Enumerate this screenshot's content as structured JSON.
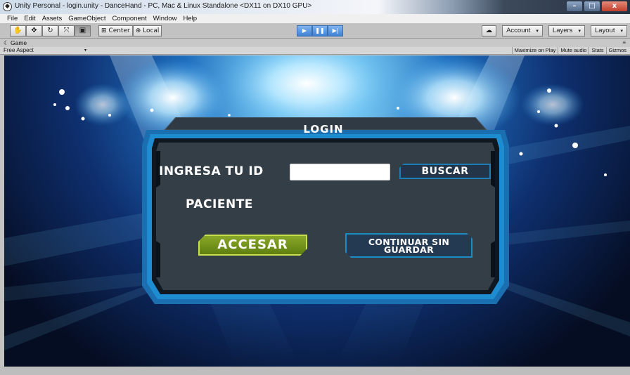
{
  "window": {
    "title": "Unity Personal - login.unity - DanceHand - PC, Mac & Linux Standalone <DX11 on DX10 GPU>",
    "controls": {
      "minimize": "–",
      "maximize": "□",
      "close": "x"
    }
  },
  "menubar": {
    "items": [
      "File",
      "Edit",
      "Assets",
      "GameObject",
      "Component",
      "Window",
      "Help"
    ]
  },
  "toolbar": {
    "tools": [
      {
        "name": "hand-tool",
        "glyph": "✋"
      },
      {
        "name": "move-tool",
        "glyph": "✥"
      },
      {
        "name": "rotate-tool",
        "glyph": "↻"
      },
      {
        "name": "scale-tool",
        "glyph": "⤧"
      },
      {
        "name": "rect-tool",
        "glyph": "▣"
      }
    ],
    "pivot_label": "Center",
    "space_label": "Local",
    "play": {
      "play_glyph": "▶",
      "pause_glyph": "❚❚",
      "step_glyph": "▶|"
    },
    "cloud_glyph": "☁",
    "account_label": "Account",
    "layers_label": "Layers",
    "layout_label": "Layout",
    "dropdown_arrow": "▾"
  },
  "game_tab": {
    "tab_label": "Game",
    "aspect_label": "Free Aspect",
    "options": [
      "Maximize on Play",
      "Mute audio",
      "Stats",
      "Gizmos"
    ]
  },
  "login": {
    "title": "LOGIN",
    "id_label": "INGRESA TU ID",
    "id_value": "",
    "search_button": "BUSCAR",
    "patient_label": "PACIENTE",
    "submit_button": "ACCESAR",
    "continue_button": "CONTINUAR SIN GUARDAR"
  },
  "colors": {
    "accent_play": "#3f82d6",
    "panel_frame": "#1b7fb6",
    "panel_body": "#343e47",
    "accesar_green": "#7a9a1f"
  }
}
